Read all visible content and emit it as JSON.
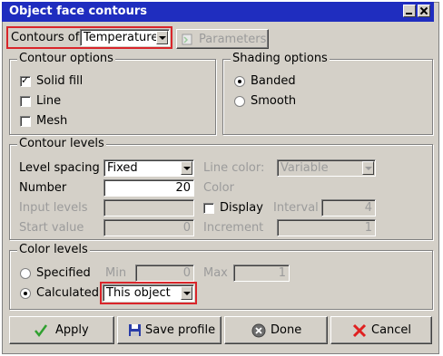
{
  "window": {
    "title": "Object face contours"
  },
  "toolbar": {
    "contours_of_label": "Contours of",
    "contours_of_value": "Temperature",
    "parameters_label": "Parameters"
  },
  "contour_options": {
    "legend": "Contour options",
    "solid_fill": {
      "label": "Solid fill",
      "checked": true
    },
    "line": {
      "label": "Line",
      "checked": false
    },
    "mesh": {
      "label": "Mesh",
      "checked": false
    }
  },
  "shading_options": {
    "legend": "Shading options",
    "banded": {
      "label": "Banded",
      "selected": true
    },
    "smooth": {
      "label": "Smooth",
      "selected": false
    }
  },
  "contour_levels": {
    "legend": "Contour levels",
    "level_spacing_label": "Level spacing",
    "level_spacing_value": "Fixed",
    "line_color_label": "Line color:",
    "line_color_value": "Variable",
    "number_label": "Number",
    "number_value": "20",
    "color_label": "Color",
    "input_levels_label": "Input levels",
    "display_label": "Display",
    "interval_label": "Interval",
    "interval_value": "4",
    "start_value_label": "Start value",
    "start_value_value": "0",
    "increment_label": "Increment",
    "increment_value": "1"
  },
  "color_levels": {
    "legend": "Color levels",
    "specified_label": "Specified",
    "min_label": "Min",
    "min_value": "0",
    "max_label": "Max",
    "max_value": "1",
    "calculated_label": "Calculated",
    "calculated_value": "This object"
  },
  "buttons": {
    "apply": "Apply",
    "save_profile": "Save profile",
    "done": "Done",
    "cancel": "Cancel"
  },
  "colors": {
    "title_bar": "#1f2dbf",
    "highlight_outline": "#d9252a",
    "dialog_bg": "#d4d0c8"
  }
}
